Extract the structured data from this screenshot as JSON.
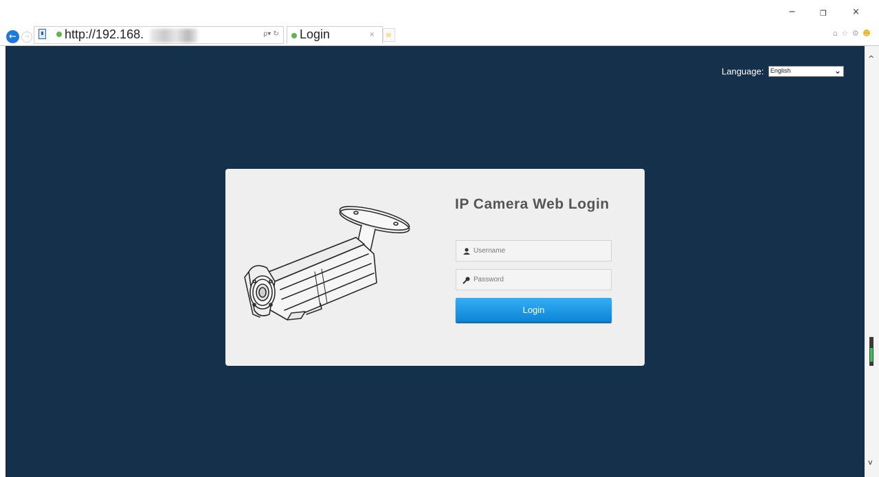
{
  "browser": {
    "url_text": "http://192.168.",
    "search_dropdown": "ρ▾ ↻",
    "tab_title": "Login",
    "tab_close": "×",
    "window_controls": {
      "minimize": "−",
      "maximize": "❐",
      "close": "×"
    },
    "toolbar_icons": [
      "home-icon",
      "favorites-star-icon",
      "settings-gear-icon",
      "feedback-smiley-icon"
    ],
    "toolbar_glyphs": {
      "home": "⌂",
      "star": "☆",
      "gear": "⚙",
      "smiley": "☻"
    },
    "nav": {
      "back": "←",
      "forward": "→"
    }
  },
  "page": {
    "language_label": "Language:",
    "language_selected": "English",
    "login_title": "IP Camera Web Login",
    "username_placeholder": "Username",
    "password_placeholder": "Password",
    "login_button": "Login"
  },
  "colors": {
    "page_background": "#14304a",
    "panel_background": "#efefef",
    "login_button": "#1a95e4",
    "title_text": "#555555"
  },
  "scrollbar": {
    "up": "^",
    "down": "v"
  }
}
